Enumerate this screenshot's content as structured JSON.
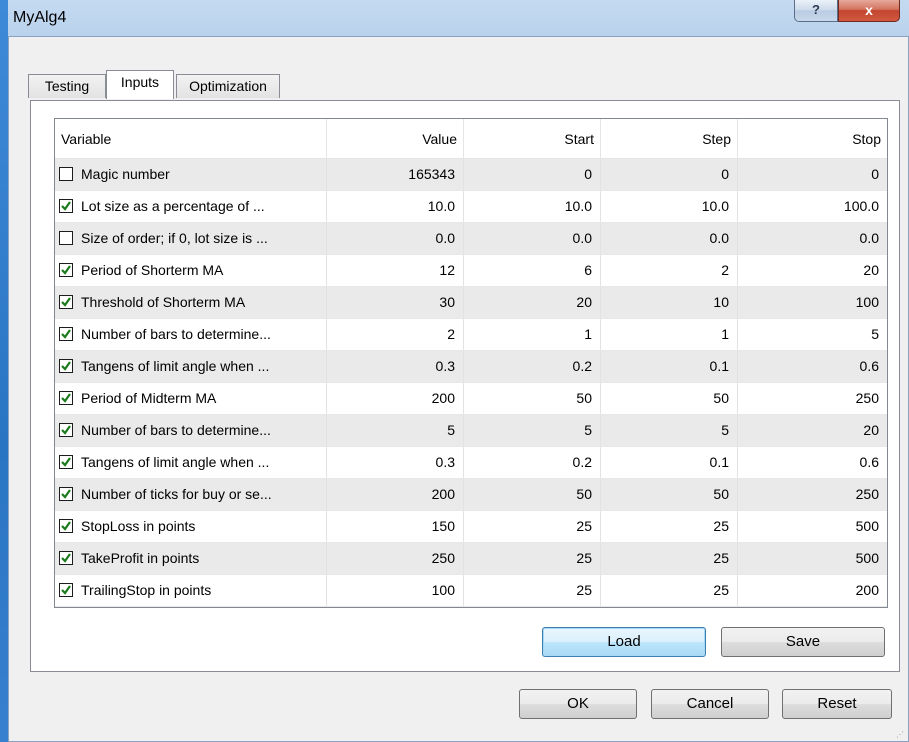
{
  "window": {
    "title": "MyAlg4"
  },
  "titlebar": {
    "help_label": "?",
    "close_label": "x"
  },
  "tabs": [
    {
      "label": "Testing",
      "active": false
    },
    {
      "label": "Inputs",
      "active": true
    },
    {
      "label": "Optimization",
      "active": false
    }
  ],
  "grid": {
    "headers": {
      "variable": "Variable",
      "value": "Value",
      "start": "Start",
      "step": "Step",
      "stop": "Stop"
    },
    "rows": [
      {
        "checked": false,
        "variable": "Magic number",
        "value": "165343",
        "start": "0",
        "step": "0",
        "stop": "0"
      },
      {
        "checked": true,
        "variable": "Lot size as a percentage of ...",
        "value": "10.0",
        "start": "10.0",
        "step": "10.0",
        "stop": "100.0"
      },
      {
        "checked": false,
        "variable": "Size of order; if 0, lot size is ...",
        "value": "0.0",
        "start": "0.0",
        "step": "0.0",
        "stop": "0.0"
      },
      {
        "checked": true,
        "variable": "Period of Shorterm MA",
        "value": "12",
        "start": "6",
        "step": "2",
        "stop": "20"
      },
      {
        "checked": true,
        "variable": "Threshold of Shorterm MA",
        "value": "30",
        "start": "20",
        "step": "10",
        "stop": "100"
      },
      {
        "checked": true,
        "variable": "Number of bars to determine...",
        "value": "2",
        "start": "1",
        "step": "1",
        "stop": "5"
      },
      {
        "checked": true,
        "variable": "Tangens of limit angle when ...",
        "value": "0.3",
        "start": "0.2",
        "step": "0.1",
        "stop": "0.6"
      },
      {
        "checked": true,
        "variable": "Period of Midterm MA",
        "value": "200",
        "start": "50",
        "step": "50",
        "stop": "250"
      },
      {
        "checked": true,
        "variable": "Number of bars to determine...",
        "value": "5",
        "start": "5",
        "step": "5",
        "stop": "20"
      },
      {
        "checked": true,
        "variable": "Tangens of limit angle when ...",
        "value": "0.3",
        "start": "0.2",
        "step": "0.1",
        "stop": "0.6"
      },
      {
        "checked": true,
        "variable": "Number of ticks for buy or se...",
        "value": "200",
        "start": "50",
        "step": "50",
        "stop": "250"
      },
      {
        "checked": true,
        "variable": "StopLoss in points",
        "value": "150",
        "start": "25",
        "step": "25",
        "stop": "500"
      },
      {
        "checked": true,
        "variable": "TakeProfit in points",
        "value": "250",
        "start": "25",
        "step": "25",
        "stop": "500"
      },
      {
        "checked": true,
        "variable": "TrailingStop in points",
        "value": "100",
        "start": "25",
        "step": "25",
        "stop": "200"
      }
    ]
  },
  "panel_buttons": {
    "load_label": "Load",
    "save_label": "Save"
  },
  "dialog_buttons": {
    "ok_label": "OK",
    "cancel_label": "Cancel",
    "reset_label": "Reset"
  },
  "colors": {
    "checkmark": "#1b7a1b",
    "focus_border": "#3c7fb1",
    "close_red": "#c24530"
  }
}
